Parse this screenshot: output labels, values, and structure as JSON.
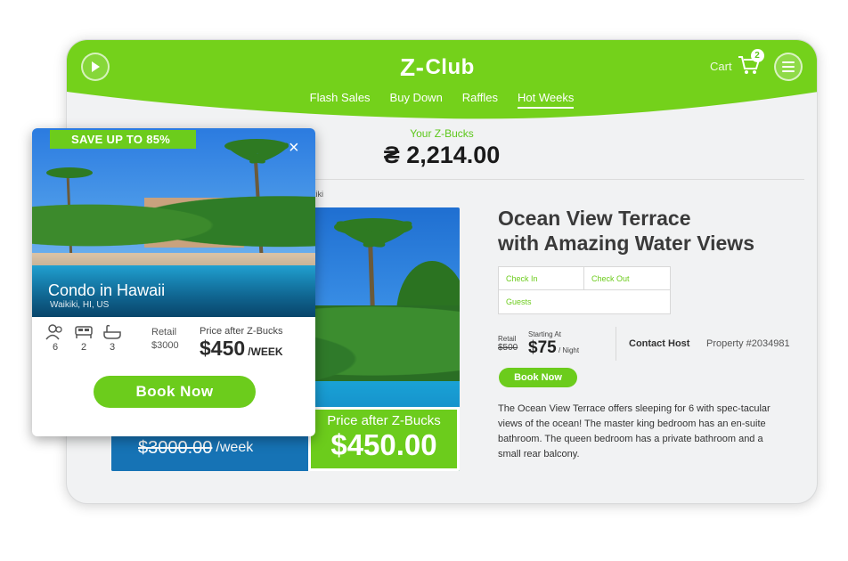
{
  "brand": {
    "logo_text": "Club",
    "logo_mark": "Z-",
    "accent": "#6ccc1c",
    "accent_light": "#7ed321"
  },
  "header": {
    "cart_label": "Cart",
    "cart_count": "2",
    "nav": [
      {
        "label": "Flash Sales"
      },
      {
        "label": "Buy Down"
      },
      {
        "label": "Raffles"
      },
      {
        "label": "Hot Weeks",
        "active": true
      }
    ]
  },
  "zbucks": {
    "label": "Your Z-Bucks",
    "amount": "₴ 2,214.00"
  },
  "breadcrumb": "aikiki",
  "listing": {
    "title_line1": "Ocean View Terrace",
    "title_line2": "with Amazing Water Views",
    "check_in": "Check In",
    "check_out": "Check Out",
    "guests": "Guests",
    "retail_label": "Retail",
    "retail_price": "$500",
    "starting_label": "Starting At",
    "starting_price": "$75",
    "per_night": "/ Night",
    "contact_host": "Contact Host",
    "property": "Property #2034981",
    "book_now": "Book Now",
    "description": "The Ocean View Terrace offers sleeping for 6 with spec-tacular views of the ocean! The master king bedroom has an en-suite bathroom. The queen bedroom has a private bathroom and a small rear balcony.",
    "old_price": "$3000.00",
    "per_week": "/week",
    "after_label": "Price after Z-Bucks",
    "after_price": "$450.00"
  },
  "card": {
    "save_tag": "SAVE UP TO 85%",
    "close_icon": "×",
    "title": "Condo in Hawaii",
    "location": "Waikiki, HI, US",
    "guests": "6",
    "beds": "2",
    "baths": "3",
    "retail_label": "Retail",
    "retail_price": "$3000",
    "after_label": "Price after Z-Bucks",
    "after_price": "$450",
    "per_week": "/WEEK",
    "book_now": "Book Now"
  }
}
